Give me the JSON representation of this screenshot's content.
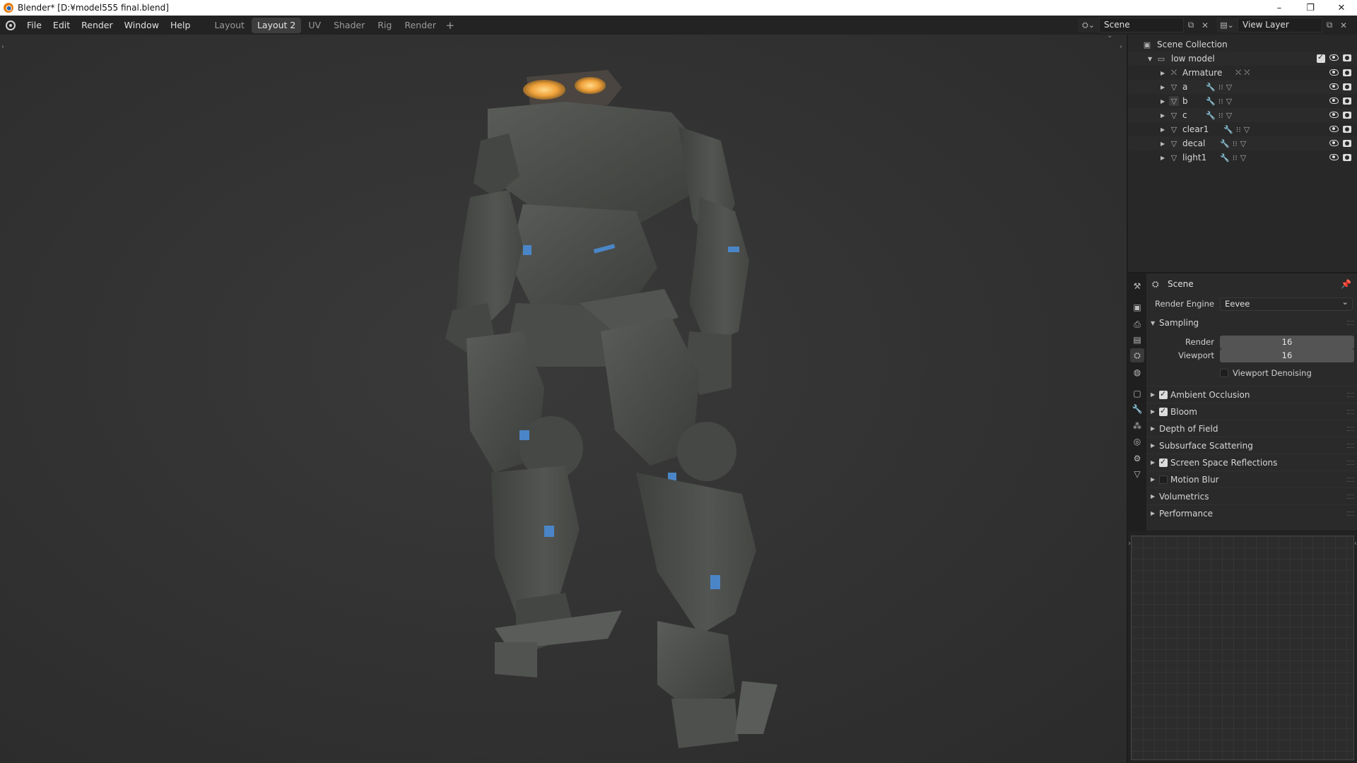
{
  "window": {
    "title": "Blender* [D:¥model555 final.blend]",
    "controls": [
      "–",
      "❐",
      "✕"
    ]
  },
  "menu": [
    "File",
    "Edit",
    "Render",
    "Window",
    "Help"
  ],
  "workspaces": {
    "tabs": [
      "Layout",
      "Layout 2",
      "UV",
      "Shader",
      "Rig",
      "Render"
    ],
    "active": "Layout 2",
    "add": "+"
  },
  "scene_selector": {
    "scene": "Scene",
    "view_layer": "View Layer"
  },
  "outliner": {
    "root": "Scene Collection",
    "collection": "low model",
    "objects": [
      {
        "name": "Armature",
        "type": "armature"
      },
      {
        "name": "a",
        "type": "mesh"
      },
      {
        "name": "b",
        "type": "mesh"
      },
      {
        "name": "c",
        "type": "mesh"
      },
      {
        "name": "clear1",
        "type": "mesh"
      },
      {
        "name": "decal",
        "type": "mesh"
      },
      {
        "name": "light1",
        "type": "mesh"
      }
    ]
  },
  "properties": {
    "context": "Scene",
    "render_engine_label": "Render Engine",
    "render_engine": "Eevee",
    "sampling": {
      "title": "Sampling",
      "render_label": "Render",
      "render": "16",
      "viewport_label": "Viewport",
      "viewport": "16",
      "denoise_label": "Viewport Denoising",
      "denoise": false
    },
    "panels": [
      {
        "label": "Ambient Occlusion",
        "checkbox": true,
        "checked": true
      },
      {
        "label": "Bloom",
        "checkbox": true,
        "checked": true
      },
      {
        "label": "Depth of Field",
        "checkbox": false
      },
      {
        "label": "Subsurface Scattering",
        "checkbox": false
      },
      {
        "label": "Screen Space Reflections",
        "checkbox": true,
        "checked": true
      },
      {
        "label": "Motion Blur",
        "checkbox": true,
        "checked": false
      },
      {
        "label": "Volumetrics",
        "checkbox": false
      },
      {
        "label": "Performance",
        "checkbox": false
      }
    ]
  },
  "colors": {
    "viewport_bg": "#333333",
    "panel_bg": "#2a2a2a",
    "model": "#4c4e4b",
    "accent_blue": "#4a86c7",
    "glow": "#f0a23a"
  }
}
